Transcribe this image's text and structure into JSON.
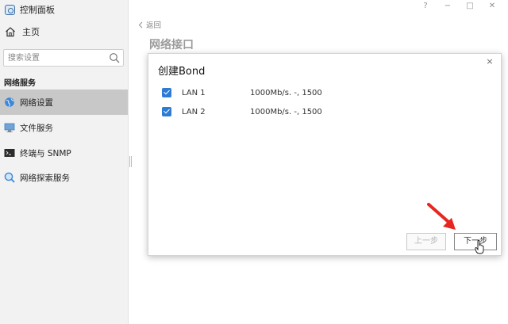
{
  "app": {
    "title": "控制面板"
  },
  "sidebar": {
    "home_label": "主页",
    "search_placeholder": "搜索设置",
    "section_title": "网络服务",
    "items": [
      {
        "label": "网络设置",
        "icon": "globe-icon",
        "active": true
      },
      {
        "label": "文件服务",
        "icon": "monitor-icon",
        "active": false
      },
      {
        "label": "终端与 SNMP",
        "icon": "terminal-icon",
        "active": false
      },
      {
        "label": "网络探索服务",
        "icon": "magnifier-icon",
        "active": false
      }
    ]
  },
  "window": {
    "help": "?",
    "minimize": "−",
    "maximize": "□",
    "close": "✕"
  },
  "main": {
    "back_label": "返回",
    "page_title": "网络接口"
  },
  "dialog": {
    "title": "创建Bond",
    "close": "×",
    "rows": [
      {
        "name": "LAN 1",
        "info": "1000Mb/s. -, 1500",
        "checked": true
      },
      {
        "name": "LAN 2",
        "info": "1000Mb/s. -, 1500",
        "checked": true
      }
    ],
    "prev_label": "上一步",
    "next_label": "下一步"
  },
  "colors": {
    "accent": "#2e7bd6",
    "active_nav": "#c8c8c8",
    "annotation_arrow": "#e8261f"
  }
}
